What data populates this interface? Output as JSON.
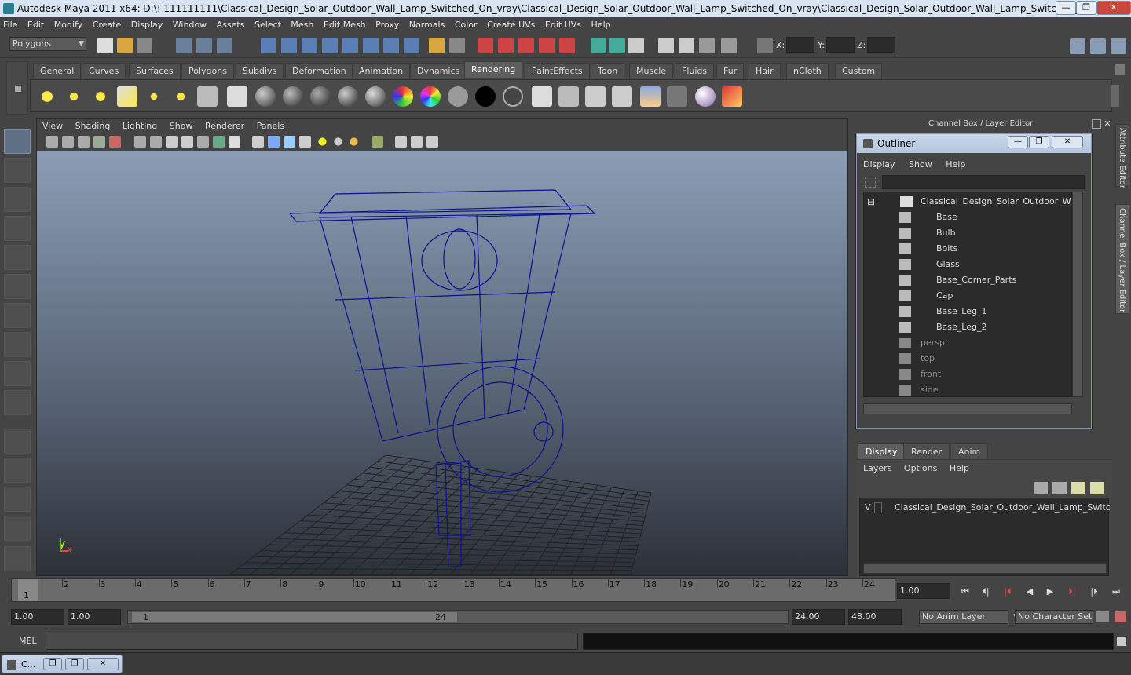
{
  "window": {
    "title": "Autodesk Maya 2011 x64: D:\\! 111111111\\Classical_Design_Solar_Outdoor_Wall_Lamp_Switched_On_vray\\Classical_Design_Solar_Outdoor_Wall_Lamp_Switched_On_vray\\Classical_Design_Solar_Outdoor_Wall_Lamp_Switched_On.mb*",
    "minimize": "—",
    "maximize": "❐",
    "close": "✕"
  },
  "menubar": [
    "File",
    "Edit",
    "Modify",
    "Create",
    "Display",
    "Window",
    "Assets",
    "Select",
    "Mesh",
    "Edit Mesh",
    "Proxy",
    "Normals",
    "Color",
    "Create UVs",
    "Edit UVs",
    "Help"
  ],
  "status": {
    "mode": "Polygons",
    "x_label": "X:",
    "y_label": "Y:",
    "z_label": "Z:"
  },
  "shelf": {
    "tabs": [
      "General",
      "Curves",
      "Surfaces",
      "Polygons",
      "Subdivs",
      "Deformation",
      "Animation",
      "Dynamics",
      "Rendering",
      "PaintEffects",
      "Toon",
      "Muscle",
      "Fluids",
      "Fur",
      "Hair",
      "nCloth",
      "Custom"
    ],
    "active_tab": "Rendering"
  },
  "viewport": {
    "menu": [
      "View",
      "Shading",
      "Lighting",
      "Show",
      "Renderer",
      "Panels"
    ],
    "axis_y": "y",
    "axis_x": "x",
    "wire_color": "#0a1290"
  },
  "channelbox": {
    "title": "Channel Box / Layer Editor",
    "side_tab_attr": "Attribute Editor",
    "side_tab_channel": "Channel Box / Layer Editor"
  },
  "outliner": {
    "title": "Outliner",
    "menu": [
      "Display",
      "Show",
      "Help"
    ],
    "root": "Classical_Design_Solar_Outdoor_Wall_L",
    "children": [
      "Base",
      "Bulb",
      "Bolts",
      "Glass",
      "Base_Corner_Parts",
      "Cap",
      "Base_Leg_1",
      "Base_Leg_2"
    ],
    "cameras": [
      "persp",
      "top",
      "front",
      "side"
    ],
    "collapse": "⊟"
  },
  "layers": {
    "tabs": [
      "Display",
      "Render",
      "Anim"
    ],
    "active_tab": "Display",
    "menu": [
      "Layers",
      "Options",
      "Help"
    ],
    "visible_flag": "V",
    "layer_name": "Classical_Design_Solar_Outdoor_Wall_Lamp_Switched_C"
  },
  "timeline": {
    "ticks": [
      "1",
      "2",
      "3",
      "4",
      "5",
      "6",
      "7",
      "8",
      "9",
      "10",
      "11",
      "12",
      "13",
      "14",
      "15",
      "16",
      "17",
      "18",
      "19",
      "20",
      "21",
      "22",
      "23",
      "24"
    ],
    "current_frame_marker": "1",
    "current_time": "1.00"
  },
  "range": {
    "start_time": "1.00",
    "playback_start": "1.00",
    "range_start": "1",
    "range_end": "24",
    "playback_end": "24.00",
    "end_time": "48.00",
    "anim_layer": "No Anim Layer",
    "character_set": "No Character Set"
  },
  "command": {
    "label": "MEL"
  },
  "taskbar": {
    "item": "C..."
  }
}
